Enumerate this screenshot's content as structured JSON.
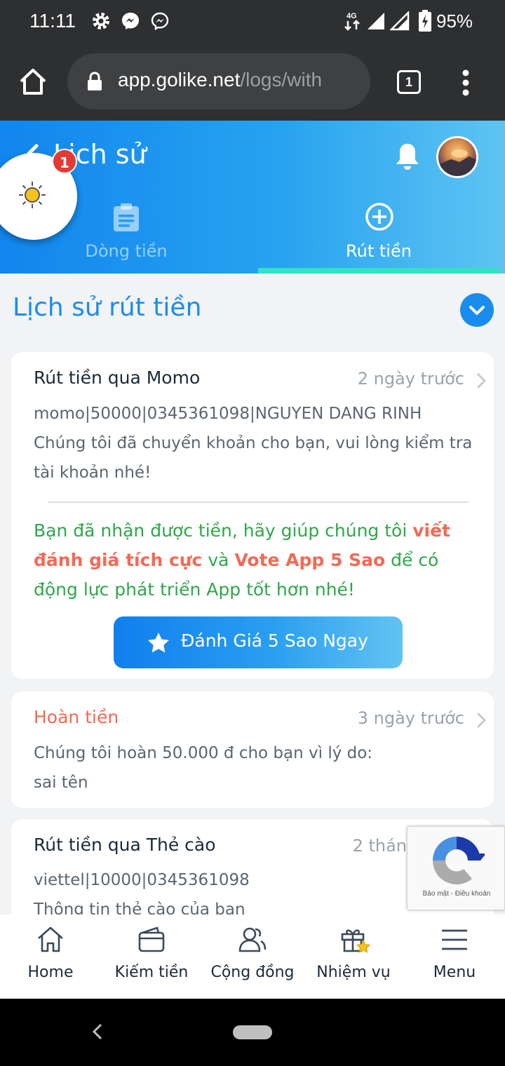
{
  "status_bar": {
    "time": "11:11",
    "network": "4G",
    "battery": "95%"
  },
  "browser": {
    "url_domain": "app.golike.net",
    "url_path": "/logs/with",
    "tab_count": "1"
  },
  "header": {
    "title": "Lịch sử",
    "tabs": [
      {
        "label": "Dòng tiền",
        "active": false
      },
      {
        "label": "Rút tiền",
        "active": true
      }
    ],
    "fab_badge": "1"
  },
  "section": {
    "title": "Lịch sử rút tiền"
  },
  "entries": [
    {
      "title": "Rút tiền qua Momo",
      "time": "2 ngày trước",
      "line1": "momo|50000|0345361098|NGUYEN DANG RINH",
      "line2": "Chúng tôi đã chuyển khoản cho bạn, vui lòng kiểm tra",
      "line3": "tài khoản nhé!",
      "promo": {
        "part1": "Bạn đã nhận được tiền, hãy giúp chúng tôi ",
        "hl1": "viết đánh giá tích cực",
        "part2": " và ",
        "hl2": "Vote App 5 Sao",
        "part3": " để có động lực phát triển App tốt hơn nhé!"
      },
      "button": "Đánh Giá 5 Sao Ngay"
    },
    {
      "title": "Hoàn tiền",
      "time": "3 ngày trước",
      "line1": "Chúng tôi hoàn 50.000 đ cho bạn vì lý do:",
      "line2": "sai tên"
    },
    {
      "title": "Rút tiền qua Thẻ cào",
      "time": "2 thán",
      "line1": "viettel|10000|0345361098",
      "line2": "Thông tin thẻ cào của bạn"
    }
  ],
  "recaptcha": {
    "text": "Bảo mật - Điều khoản"
  },
  "bottom_nav": [
    {
      "label": "Home",
      "icon": "home-icon"
    },
    {
      "label": "Kiếm tiền",
      "icon": "wallet-icon"
    },
    {
      "label": "Cộng đồng",
      "icon": "community-icon"
    },
    {
      "label": "Nhiệm vụ",
      "icon": "gift-icon"
    },
    {
      "label": "Menu",
      "icon": "menu-icon"
    }
  ],
  "colors": {
    "primary": "#1a8cee",
    "accent_teal": "#34e1c4",
    "promo_green": "#2ea84a",
    "highlight_red": "#f26a55"
  }
}
